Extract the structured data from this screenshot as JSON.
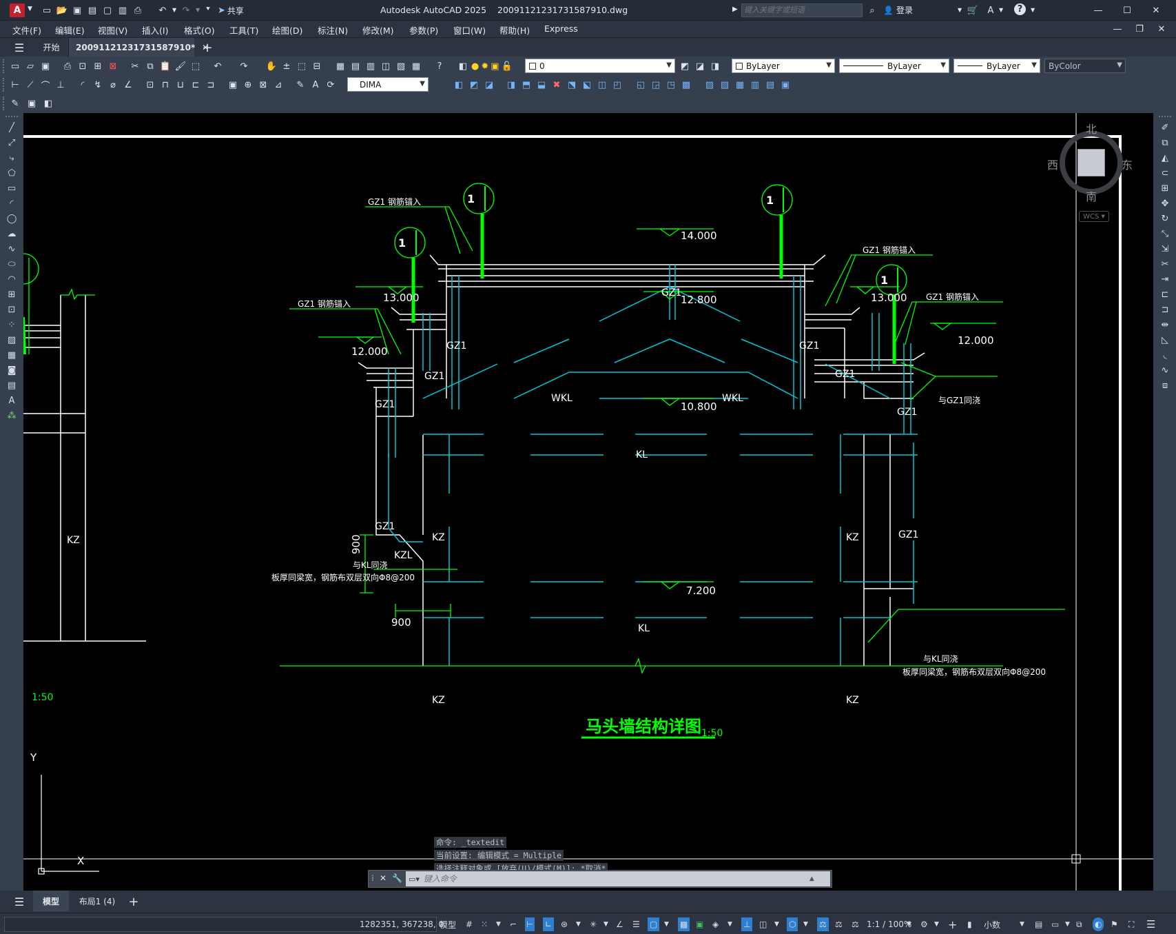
{
  "app": {
    "title": "Autodesk AutoCAD 2025",
    "filename": "20091121231731587910.dwg",
    "logo": "A",
    "share_label": "共享",
    "search_placeholder": "键入关键字或短语",
    "login_label": "登录"
  },
  "menu": [
    "文件(F)",
    "编辑(E)",
    "视图(V)",
    "插入(I)",
    "格式(O)",
    "工具(T)",
    "绘图(D)",
    "标注(N)",
    "修改(M)",
    "参数(P)",
    "窗口(W)",
    "帮助(H)",
    "Express"
  ],
  "tabs": {
    "start": "开始",
    "active": "20091121231731587910*"
  },
  "layer_combo": "0",
  "color_combo": "ByLayer",
  "linetype_combo": "ByLayer",
  "lineweight_combo": "ByLayer",
  "plotstyle_combo": "ByColor",
  "dimstyle_combo": "DIMA",
  "viewcube": {
    "north": "北",
    "south": "南",
    "east": "东",
    "west": "西",
    "wcs": "WCS"
  },
  "drawing": {
    "elev_14": "14.000",
    "elev_13_l": "13.000",
    "elev_13_r": "13.000",
    "elev_12_8": "12.800",
    "elev_12_l": "12.000",
    "elev_12_r": "12.000",
    "elev_10_8": "10.800",
    "elev_7_2": "7.200",
    "gz1_anchor_1": "GZ1 钢筋锚入",
    "gz1_anchor_2": "GZ1 钢筋锚入",
    "gz1_anchor_3": "GZ1 钢筋锚入",
    "gz1_anchor_4": "GZ1 钢筋锚入",
    "gz1": "GZ1",
    "wkl": "WKL",
    "kl": "KL",
    "kz": "KZ",
    "kzl": "KZL",
    "with_gz1": "与GZ1同浇",
    "with_kl": "与KL同浇",
    "slab_note": "板厚同梁宽，钢筋布双层双向Φ8@200",
    "dim_900": "900",
    "section_mark": "1",
    "title": "马头墙结构详图",
    "scale": "1:50"
  },
  "commands": [
    "命令: _textedit",
    "当前设置: 编辑模式 = Multiple",
    "选择注释对象或 [放弃(U)/模式(M)]: *取消*"
  ],
  "command_placeholder": "键入命令",
  "layout_tabs": {
    "model": "模型",
    "layout1": "布局1 (4)"
  },
  "status": {
    "coords": "1282351, 367238, 0",
    "model": "模型",
    "scale": "1:1 / 100%",
    "units": "小数"
  },
  "colors": {
    "green": "#00ff00",
    "cyan": "#00c8d8",
    "white": "#ffffff",
    "canvas": "#000000"
  }
}
